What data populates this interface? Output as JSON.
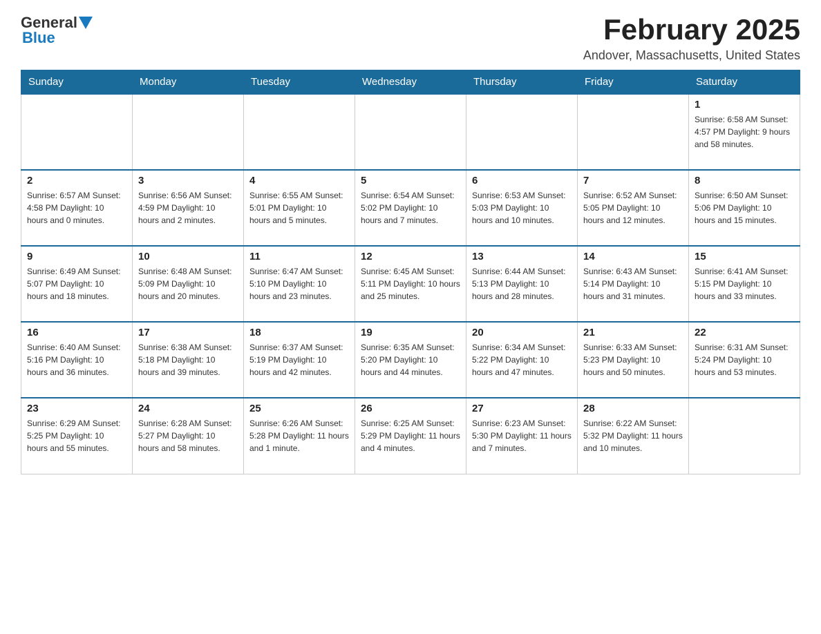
{
  "header": {
    "logo_general": "General",
    "logo_blue": "Blue",
    "month_title": "February 2025",
    "location": "Andover, Massachusetts, United States"
  },
  "weekdays": [
    "Sunday",
    "Monday",
    "Tuesday",
    "Wednesday",
    "Thursday",
    "Friday",
    "Saturday"
  ],
  "weeks": [
    [
      {
        "day": "",
        "info": ""
      },
      {
        "day": "",
        "info": ""
      },
      {
        "day": "",
        "info": ""
      },
      {
        "day": "",
        "info": ""
      },
      {
        "day": "",
        "info": ""
      },
      {
        "day": "",
        "info": ""
      },
      {
        "day": "1",
        "info": "Sunrise: 6:58 AM\nSunset: 4:57 PM\nDaylight: 9 hours and 58 minutes."
      }
    ],
    [
      {
        "day": "2",
        "info": "Sunrise: 6:57 AM\nSunset: 4:58 PM\nDaylight: 10 hours and 0 minutes."
      },
      {
        "day": "3",
        "info": "Sunrise: 6:56 AM\nSunset: 4:59 PM\nDaylight: 10 hours and 2 minutes."
      },
      {
        "day": "4",
        "info": "Sunrise: 6:55 AM\nSunset: 5:01 PM\nDaylight: 10 hours and 5 minutes."
      },
      {
        "day": "5",
        "info": "Sunrise: 6:54 AM\nSunset: 5:02 PM\nDaylight: 10 hours and 7 minutes."
      },
      {
        "day": "6",
        "info": "Sunrise: 6:53 AM\nSunset: 5:03 PM\nDaylight: 10 hours and 10 minutes."
      },
      {
        "day": "7",
        "info": "Sunrise: 6:52 AM\nSunset: 5:05 PM\nDaylight: 10 hours and 12 minutes."
      },
      {
        "day": "8",
        "info": "Sunrise: 6:50 AM\nSunset: 5:06 PM\nDaylight: 10 hours and 15 minutes."
      }
    ],
    [
      {
        "day": "9",
        "info": "Sunrise: 6:49 AM\nSunset: 5:07 PM\nDaylight: 10 hours and 18 minutes."
      },
      {
        "day": "10",
        "info": "Sunrise: 6:48 AM\nSunset: 5:09 PM\nDaylight: 10 hours and 20 minutes."
      },
      {
        "day": "11",
        "info": "Sunrise: 6:47 AM\nSunset: 5:10 PM\nDaylight: 10 hours and 23 minutes."
      },
      {
        "day": "12",
        "info": "Sunrise: 6:45 AM\nSunset: 5:11 PM\nDaylight: 10 hours and 25 minutes."
      },
      {
        "day": "13",
        "info": "Sunrise: 6:44 AM\nSunset: 5:13 PM\nDaylight: 10 hours and 28 minutes."
      },
      {
        "day": "14",
        "info": "Sunrise: 6:43 AM\nSunset: 5:14 PM\nDaylight: 10 hours and 31 minutes."
      },
      {
        "day": "15",
        "info": "Sunrise: 6:41 AM\nSunset: 5:15 PM\nDaylight: 10 hours and 33 minutes."
      }
    ],
    [
      {
        "day": "16",
        "info": "Sunrise: 6:40 AM\nSunset: 5:16 PM\nDaylight: 10 hours and 36 minutes."
      },
      {
        "day": "17",
        "info": "Sunrise: 6:38 AM\nSunset: 5:18 PM\nDaylight: 10 hours and 39 minutes."
      },
      {
        "day": "18",
        "info": "Sunrise: 6:37 AM\nSunset: 5:19 PM\nDaylight: 10 hours and 42 minutes."
      },
      {
        "day": "19",
        "info": "Sunrise: 6:35 AM\nSunset: 5:20 PM\nDaylight: 10 hours and 44 minutes."
      },
      {
        "day": "20",
        "info": "Sunrise: 6:34 AM\nSunset: 5:22 PM\nDaylight: 10 hours and 47 minutes."
      },
      {
        "day": "21",
        "info": "Sunrise: 6:33 AM\nSunset: 5:23 PM\nDaylight: 10 hours and 50 minutes."
      },
      {
        "day": "22",
        "info": "Sunrise: 6:31 AM\nSunset: 5:24 PM\nDaylight: 10 hours and 53 minutes."
      }
    ],
    [
      {
        "day": "23",
        "info": "Sunrise: 6:29 AM\nSunset: 5:25 PM\nDaylight: 10 hours and 55 minutes."
      },
      {
        "day": "24",
        "info": "Sunrise: 6:28 AM\nSunset: 5:27 PM\nDaylight: 10 hours and 58 minutes."
      },
      {
        "day": "25",
        "info": "Sunrise: 6:26 AM\nSunset: 5:28 PM\nDaylight: 11 hours and 1 minute."
      },
      {
        "day": "26",
        "info": "Sunrise: 6:25 AM\nSunset: 5:29 PM\nDaylight: 11 hours and 4 minutes."
      },
      {
        "day": "27",
        "info": "Sunrise: 6:23 AM\nSunset: 5:30 PM\nDaylight: 11 hours and 7 minutes."
      },
      {
        "day": "28",
        "info": "Sunrise: 6:22 AM\nSunset: 5:32 PM\nDaylight: 11 hours and 10 minutes."
      },
      {
        "day": "",
        "info": ""
      }
    ]
  ]
}
